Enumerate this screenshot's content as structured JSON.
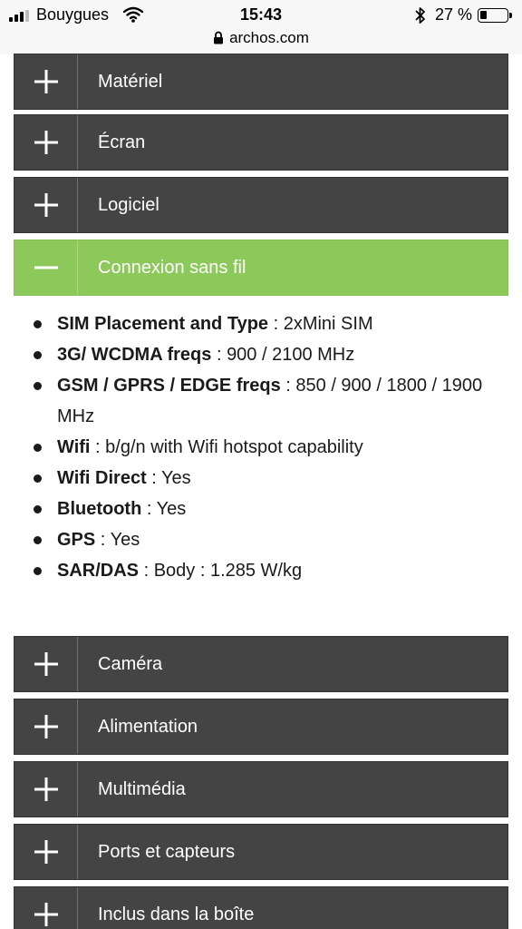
{
  "status_bar": {
    "carrier": "Bouygues",
    "time": "15:43",
    "battery_percent": "27 %",
    "battery_level": 0.27,
    "url": "archos.com"
  },
  "accordion_top": [
    {
      "label": "Matériel",
      "state": "collapsed"
    },
    {
      "label": "Écran",
      "state": "collapsed"
    },
    {
      "label": "Logiciel",
      "state": "collapsed"
    },
    {
      "label": "Connexion sans fil",
      "state": "expanded"
    }
  ],
  "connexion_specs": [
    {
      "key": "SIM Placement and Type",
      "sep": " : ",
      "value": "2xMini SIM"
    },
    {
      "key": "3G/ WCDMA freqs",
      "sep": " : ",
      "value": "900 / 2100 MHz"
    },
    {
      "key": "GSM / GPRS / EDGE freqs",
      "sep": " : ",
      "value": "850 / 900 / 1800 / 1900 MHz"
    },
    {
      "key": "Wifi",
      "sep": " : ",
      "value": "b/g/n with Wifi hotspot capability"
    },
    {
      "key": "Wifi Direct",
      "sep": " : ",
      "value": "Yes"
    },
    {
      "key": "Bluetooth",
      "sep": " : ",
      "value": "Yes"
    },
    {
      "key": "GPS",
      "sep": " : ",
      "value": "Yes"
    },
    {
      "key": "SAR/DAS",
      "sep": " : ",
      "value": "Body : 1.285 W/kg"
    }
  ],
  "accordion_bottom": [
    {
      "label": "Caméra",
      "state": "collapsed"
    },
    {
      "label": "Alimentation",
      "state": "collapsed"
    },
    {
      "label": "Multimédia",
      "state": "collapsed"
    },
    {
      "label": "Ports et capteurs",
      "state": "collapsed"
    },
    {
      "label": "Inclus dans la boîte",
      "state": "collapsed"
    }
  ],
  "icons": {
    "collapsed": "plus-icon",
    "expanded": "minus-icon"
  },
  "colors": {
    "header_dark": "#444444",
    "header_active": "#8dc85a",
    "header_text": "#ffffff"
  }
}
